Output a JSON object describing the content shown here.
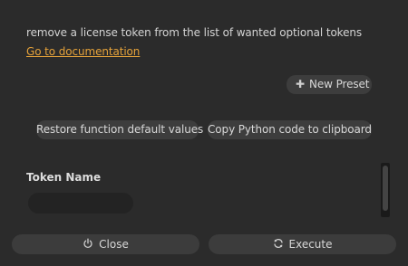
{
  "description": "remove a license token from the list of wanted optional tokens",
  "doc_link": "Go to documentation",
  "presets": {
    "new_label": "New Preset",
    "icon": "plus-icon"
  },
  "actions": {
    "restore_label": "Restore function default values",
    "copy_label": "Copy Python code to clipboard"
  },
  "params": {
    "token_name": {
      "label": "Token Name",
      "value": ""
    }
  },
  "footer": {
    "close_label": "Close",
    "close_icon": "power-icon",
    "execute_label": "Execute",
    "execute_icon": "refresh-icon"
  }
}
